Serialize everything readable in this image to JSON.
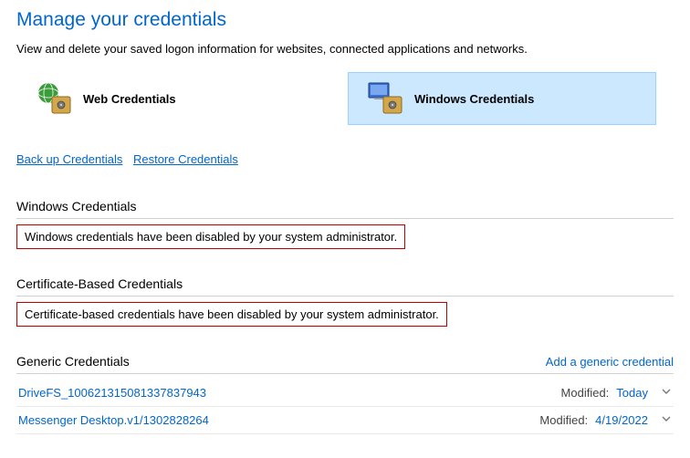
{
  "title": "Manage your credentials",
  "description": "View and delete your saved logon information for websites, connected applications and networks.",
  "tabs": {
    "web": {
      "label": "Web Credentials"
    },
    "windows": {
      "label": "Windows Credentials"
    }
  },
  "links": {
    "backup": "Back up Credentials",
    "backup_u": "B",
    "backup_rest": "ack up Credentials",
    "restore": "Restore Credentials",
    "restore_u": "R",
    "restore_rest": "estore Credentials"
  },
  "sections": {
    "windows": {
      "header": "Windows Credentials",
      "disabled_msg": "Windows credentials have been disabled by your system administrator."
    },
    "cert": {
      "header": "Certificate-Based Credentials",
      "disabled_msg": "Certificate-based credentials have been disabled by your system administrator."
    },
    "generic": {
      "header": "Generic Credentials",
      "action": "Add a generic credential",
      "items": [
        {
          "name": "DriveFS_100621315081337837943",
          "mod_label": "Modified:",
          "mod_value": "Today"
        },
        {
          "name": "Messenger Desktop.v1/1302828264",
          "mod_label": "Modified:",
          "mod_value": "4/19/2022"
        }
      ]
    }
  }
}
